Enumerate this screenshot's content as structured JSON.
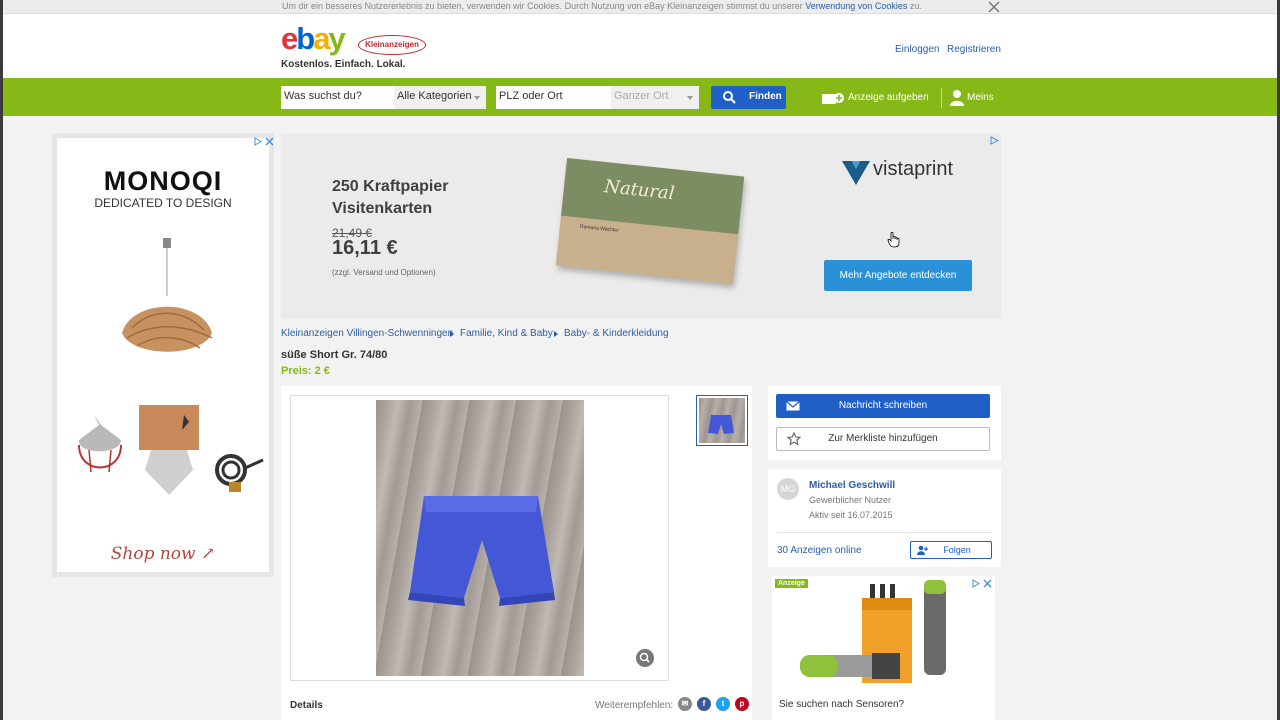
{
  "cookie_bar": {
    "text": "Um dir ein besseres Nutzererlebnis zu bieten, verwenden wir Cookies. Durch Nutzung von eBay Kleinanzeigen stimmst du unserer",
    "link": "Verwendung von Cookies",
    "suffix": "zu."
  },
  "header": {
    "logo_badge": "Kleinanzeigen",
    "tagline": "Kostenlos. Einfach. Lokal.",
    "login": "Einloggen",
    "register": "Registrieren"
  },
  "search": {
    "query_placeholder": "Was suchst du?",
    "category": "Alle Kategorien",
    "location_placeholder": "PLZ oder Ort",
    "radius": "Ganzer Ort",
    "find_label": "Finden"
  },
  "nav": {
    "post_ad": "Anzeige aufgeben",
    "my": "Meins"
  },
  "ad_left": {
    "brand": "MONOQI",
    "slogan": "DEDICATED TO DESIGN",
    "cta": "Shop now"
  },
  "ad_top": {
    "title_line1": "250 Kraftpapier",
    "title_line2": "Visitenkarten",
    "old_price": "21,49 €",
    "new_price": "16,11 €",
    "note": "(zzgl. Versand und Optionen)",
    "card_label": "Natural",
    "card_name": "Ramona Wächter",
    "brand": "vistaprint",
    "cta": "Mehr Angebote entdecken"
  },
  "breadcrumb": [
    "Kleinanzeigen Villingen-Schwenningen",
    "Familie, Kind & Baby",
    "Baby- & Kinderkleidung"
  ],
  "listing": {
    "title": "süße Short Gr. 74/80",
    "price": "Preis: 2 €",
    "details_label": "Details",
    "share_label": "Weiterempfehlen:"
  },
  "actions": {
    "message": "Nachricht schreiben",
    "watchlist": "Zur Merkliste hinzufügen"
  },
  "seller": {
    "initials": "MG",
    "name": "Michael Geschwill",
    "type": "Gewerblicher Nutzer",
    "since": "Aktiv seit 16.07.2015",
    "ads_online": "30 Anzeigen online",
    "follow": "Folgen"
  },
  "ad_right": {
    "badge": "Anzeige",
    "text": "Sie suchen nach Sensoren?"
  },
  "colors": {
    "green": "#86b817",
    "blue": "#1f5fc6",
    "link": "#2a5ea8"
  }
}
